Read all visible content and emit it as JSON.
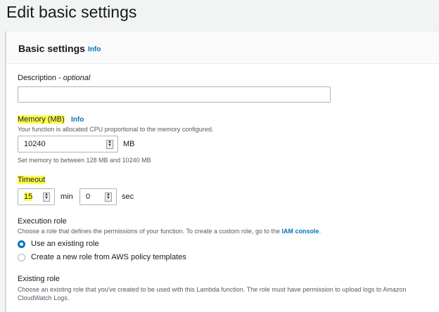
{
  "page_title": "Edit basic settings",
  "section": {
    "title": "Basic settings",
    "info": "Info"
  },
  "description": {
    "label": "Description - ",
    "optional": "optional",
    "value": ""
  },
  "memory": {
    "label": "Memory (MB)",
    "info": "Info",
    "help": "Your function is allocated CPU proportional to the memory configured.",
    "value": "10240",
    "unit": "MB",
    "constraint": "Set memory to between 128 MB and 10240 MB"
  },
  "timeout": {
    "label": "Timeout",
    "min_value": "15",
    "min_unit": "min",
    "sec_value": "0",
    "sec_unit": "sec"
  },
  "execution_role": {
    "label": "Execution role",
    "help": "Choose a role that defines the permissions of your function. To create a custom role, go to the ",
    "help_link": "IAM console",
    "help_end": ".",
    "options": [
      "Use an existing role",
      "Create a new role from AWS policy templates"
    ]
  },
  "existing_role": {
    "label": "Existing role",
    "help_line1": "Choose an existing role that you've created to be used with this Lambda function. The role must have permission to upload logs to Amazon",
    "help_line2": "CloudWatch Logs."
  },
  "colors": {
    "accent": "#0073bb",
    "highlight": "#ffff4d"
  }
}
